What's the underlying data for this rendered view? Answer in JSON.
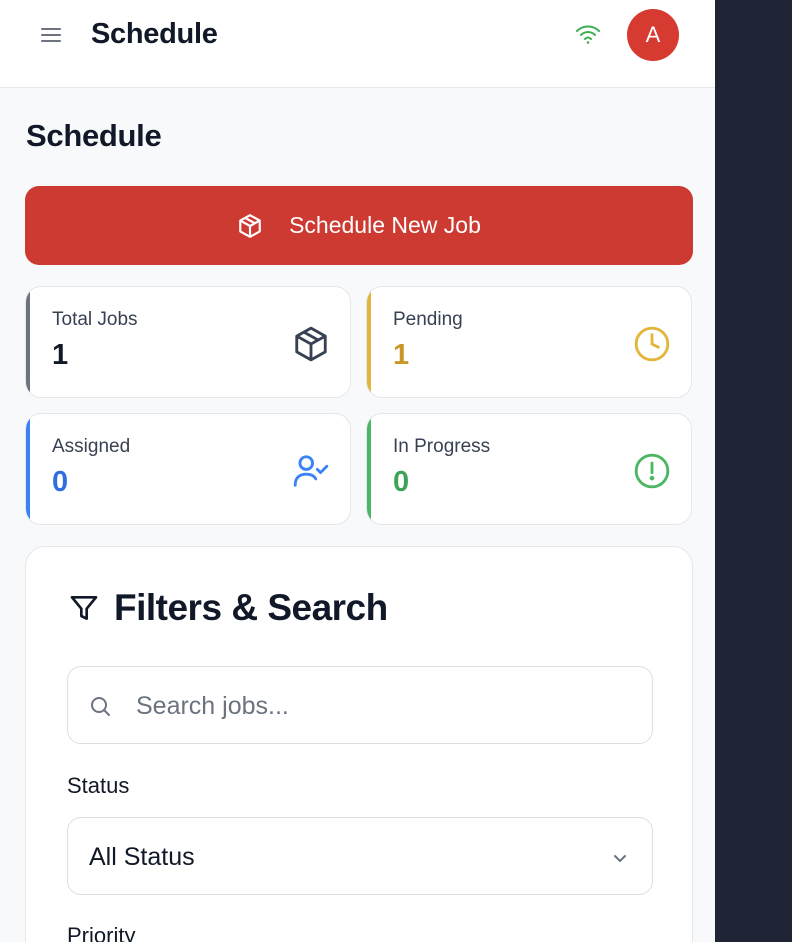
{
  "header": {
    "title": "Schedule",
    "avatar_initial": "A"
  },
  "page": {
    "title": "Schedule",
    "primary_action": "Schedule New Job"
  },
  "stats": [
    {
      "label": "Total Jobs",
      "value": "1",
      "accent": "#6b7280",
      "value_color": "#111827",
      "icon": "box-icon"
    },
    {
      "label": "Pending",
      "value": "1",
      "accent": "#e3b53b",
      "value_color": "#c9962a",
      "icon": "clock-icon"
    },
    {
      "label": "Assigned",
      "value": "0",
      "accent": "#3b82f6",
      "value_color": "#2f6fe0",
      "icon": "user-check-icon"
    },
    {
      "label": "In Progress",
      "value": "0",
      "accent": "#4bb763",
      "value_color": "#3da357",
      "icon": "alert-circle-icon"
    }
  ],
  "filters": {
    "title": "Filters & Search",
    "search_placeholder": "Search jobs...",
    "status_label": "Status",
    "status_value": "All Status",
    "priority_label": "Priority"
  },
  "colors": {
    "brand": "#cd3a31",
    "sidebar_bg": "#1f2535"
  }
}
